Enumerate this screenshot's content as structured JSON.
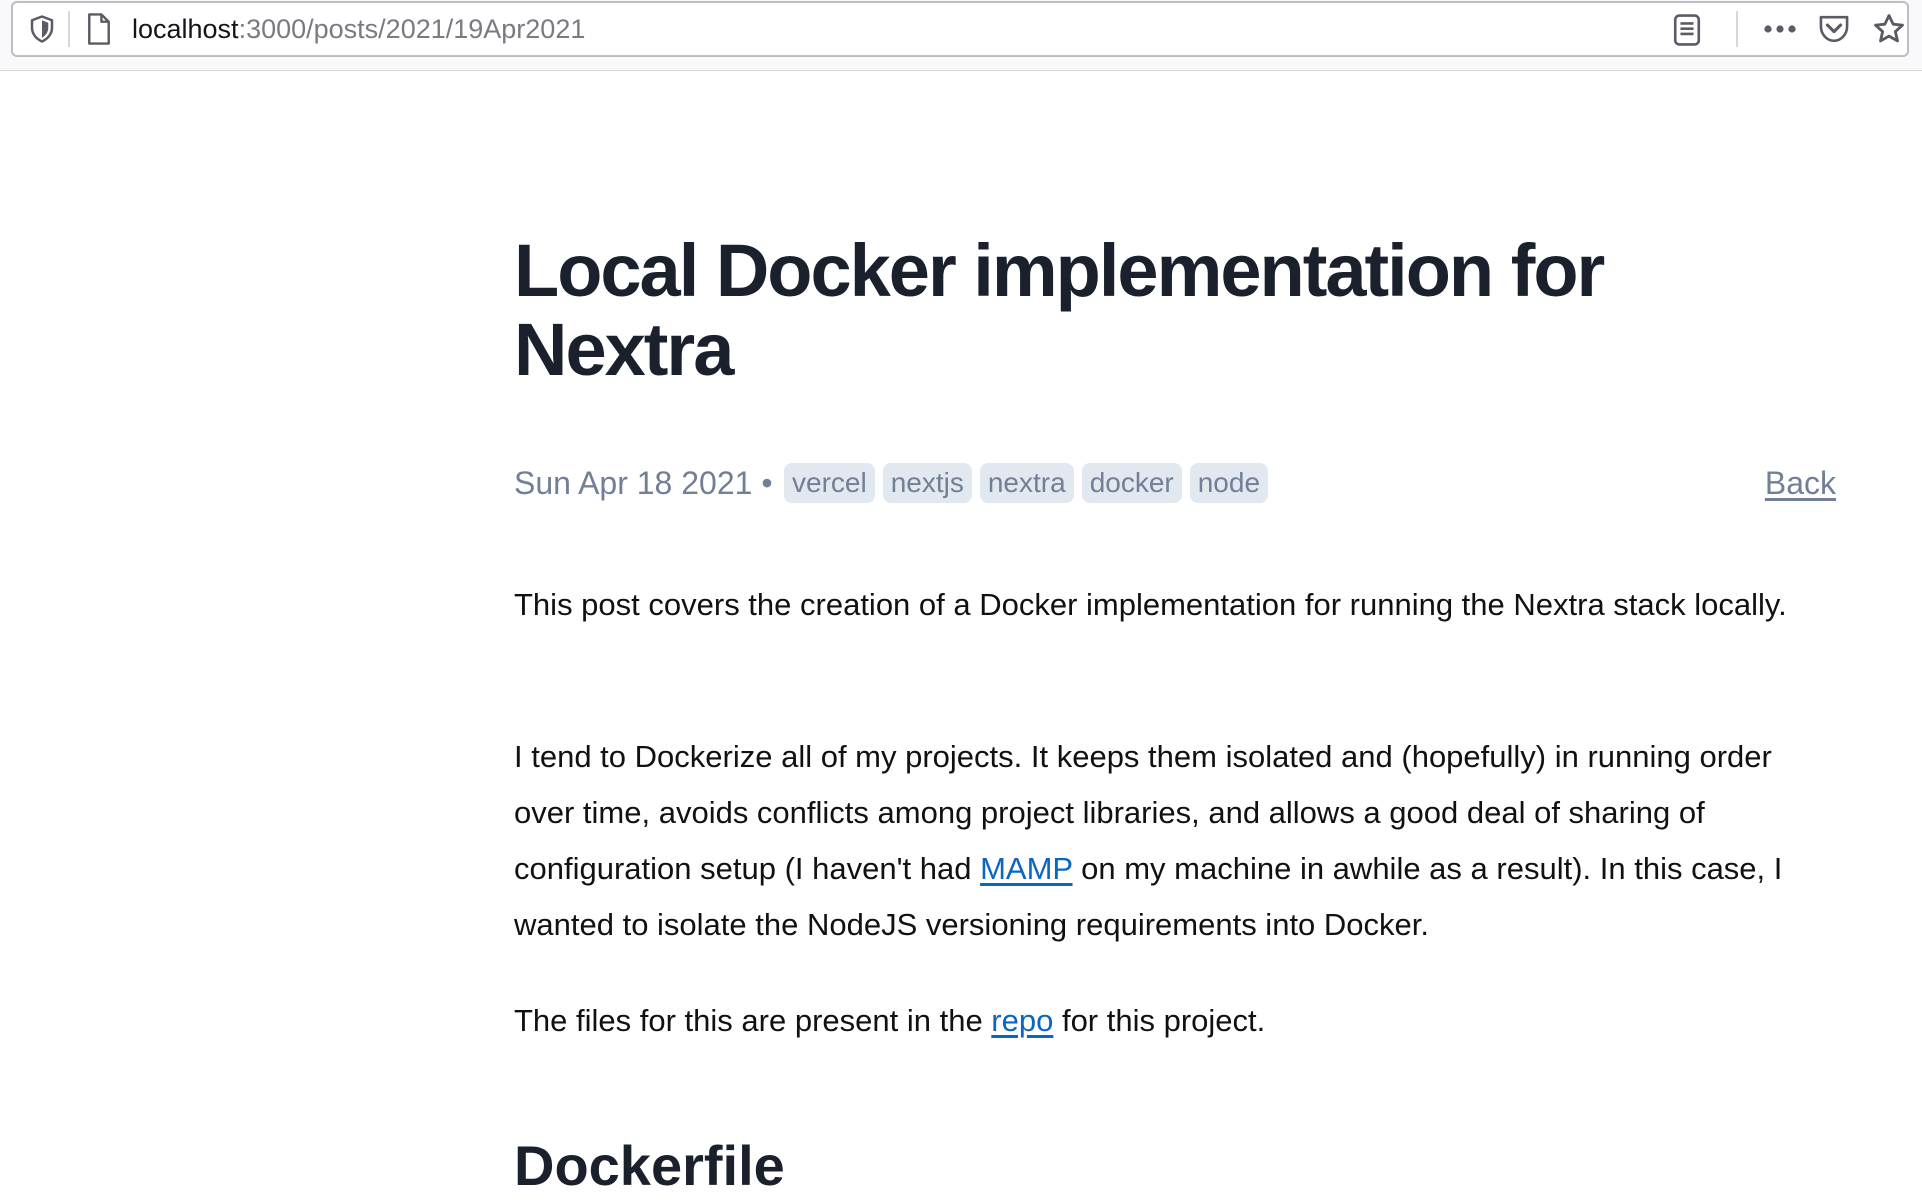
{
  "browser": {
    "url_host": "localhost",
    "url_path": ":3000/posts/2021/19Apr2021",
    "icons": [
      "shield-icon",
      "page-icon",
      "reader-view-icon",
      "more-icon",
      "pocket-icon",
      "bookmark-star-icon"
    ]
  },
  "post": {
    "title": "Local Docker implementation for Nextra",
    "date": "Sun Apr 18 2021 •",
    "tags": [
      "vercel",
      "nextjs",
      "nextra",
      "docker",
      "node"
    ],
    "back_label": "Back",
    "p1": "This post covers the creation of a Docker implementation for running the Nextra stack locally.",
    "p2_before": "I tend to Dockerize all of my projects. It keeps them isolated and (hopefully) in running order over time, avoids conflicts among project libraries, and allows a good deal of sharing of configuration setup (I haven't had ",
    "p2_link": "MAMP",
    "p2_after": " on my machine in awhile as a result). In this case, I wanted to isolate the NodeJS versioning requirements into Docker.",
    "p3_before": "The files for this are present in the ",
    "p3_link": "repo",
    "p3_after": " for this project.",
    "section_heading": "Dockerfile"
  },
  "colors": {
    "title": "#1a202c",
    "meta": "#718096",
    "tag_bg": "#e2e8f0",
    "link": "#0a66c2"
  }
}
